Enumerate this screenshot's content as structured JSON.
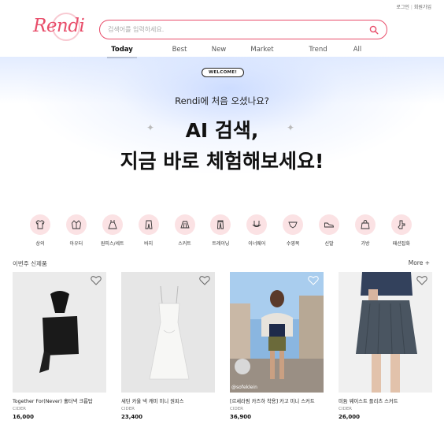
{
  "auth": {
    "login": "로그인",
    "separator": "|",
    "signup": "회원가입"
  },
  "brand": {
    "logo_text": "Rendi",
    "accent_color": "#e84d6a"
  },
  "search": {
    "placeholder": "검색어를 입력하세요."
  },
  "nav": {
    "tabs": [
      "Today",
      "Best",
      "New",
      "Market",
      "Trend",
      "All"
    ],
    "active": "Today"
  },
  "hero": {
    "badge": "WELCOME!",
    "question": "Rendi에 처음 오셨나요?",
    "line1": "AI 검색,",
    "line2": "지금 바로 체험해보세요!"
  },
  "categories": [
    {
      "label": "상의",
      "icon": "top-icon"
    },
    {
      "label": "아우터",
      "icon": "outer-icon"
    },
    {
      "label": "원피스/세트",
      "icon": "dress-icon"
    },
    {
      "label": "바지",
      "icon": "pants-icon"
    },
    {
      "label": "스커트",
      "icon": "skirt-icon"
    },
    {
      "label": "트레이닝",
      "icon": "training-icon"
    },
    {
      "label": "이너웨어",
      "icon": "innerwear-icon"
    },
    {
      "label": "수영복",
      "icon": "swimwear-icon"
    },
    {
      "label": "신발",
      "icon": "shoe-icon"
    },
    {
      "label": "가방",
      "icon": "bag-icon"
    },
    {
      "label": "패션잡화",
      "icon": "accessory-icon"
    }
  ],
  "section": {
    "title": "이번주 신제품",
    "more": "More +"
  },
  "products": [
    {
      "name": "Together For(Never) 홀터넥 크롭탑",
      "brand": "CIDER",
      "price": "16,000",
      "tag": ""
    },
    {
      "name": "새틴 카울 넥 캐미 미니 원피스",
      "brand": "CIDER",
      "price": "23,400",
      "tag": ""
    },
    {
      "name": "[르세라핌 카즈하 착용] 카고 미니 스커트",
      "brand": "CIDER",
      "price": "36,900",
      "tag": "@sofeklein"
    },
    {
      "name": "미듐 웨이스트 플리츠 스커트",
      "brand": "CIDER",
      "price": "26,000",
      "tag": ""
    }
  ]
}
